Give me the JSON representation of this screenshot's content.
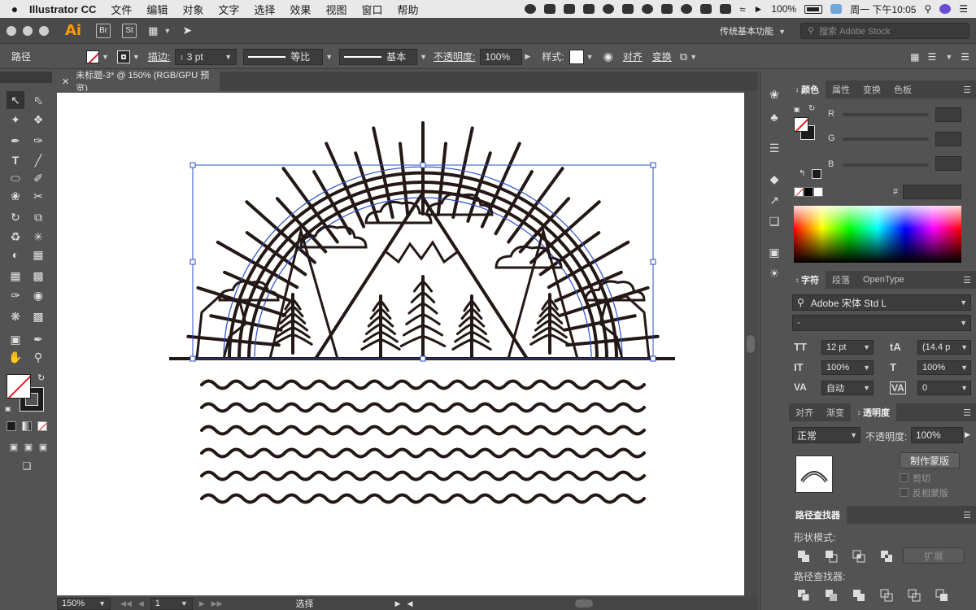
{
  "menubar": {
    "app_name": "Illustrator CC",
    "items": [
      "文件",
      "编辑",
      "对象",
      "文字",
      "选择",
      "效果",
      "视图",
      "窗口",
      "帮助"
    ],
    "battery": "100%",
    "clock": "周一 下午10:05"
  },
  "apphead": {
    "logo": "Ai",
    "bridge": "Br",
    "stock_app": "St",
    "workspace": "传统基本功能",
    "search_placeholder": "搜索 Adobe Stock"
  },
  "control": {
    "selection_label": "路径",
    "stroke_label": "描边:",
    "stroke_value": "3 pt",
    "profile1": "等比",
    "profile2": "基本",
    "opacity_label": "不透明度:",
    "opacity_value": "100%",
    "style_label": "样式:",
    "align_label": "对齐",
    "transform_label": "变换"
  },
  "document": {
    "tab_title": "未标题-3* @ 150% (RGB/GPU 预览)",
    "zoom": "150%",
    "page": "1",
    "status": "选择"
  },
  "color_panel": {
    "tabs": [
      "颜色",
      "属性",
      "变换",
      "色板"
    ],
    "channels": [
      "R",
      "G",
      "B"
    ],
    "hex_label": "#"
  },
  "char_panel": {
    "tabs": [
      "字符",
      "段落",
      "OpenType"
    ],
    "font_family": "Adobe 宋体 Std L",
    "font_style": "-",
    "font_size": "12 pt",
    "leading": "(14.4 p",
    "vscale": "100%",
    "hscale": "100%",
    "kerning": "自动",
    "tracking": "0"
  },
  "transparency_panel": {
    "tabs": [
      "对齐",
      "渐变",
      "透明度"
    ],
    "blend_mode": "正常",
    "opacity_label": "不透明度:",
    "opacity_value": "100%",
    "make_mask": "制作蒙版",
    "clip": "剪切",
    "invert": "反相蒙版"
  },
  "pathfinder_panel": {
    "title": "路径查找器",
    "shape_modes": "形状模式:",
    "pathfinders": "路径查找器:",
    "expand": "扩展"
  },
  "colors": {
    "accent_orange": "#ff9a00",
    "selection_blue": "#2b4cc9",
    "art_ink": "#231815"
  }
}
